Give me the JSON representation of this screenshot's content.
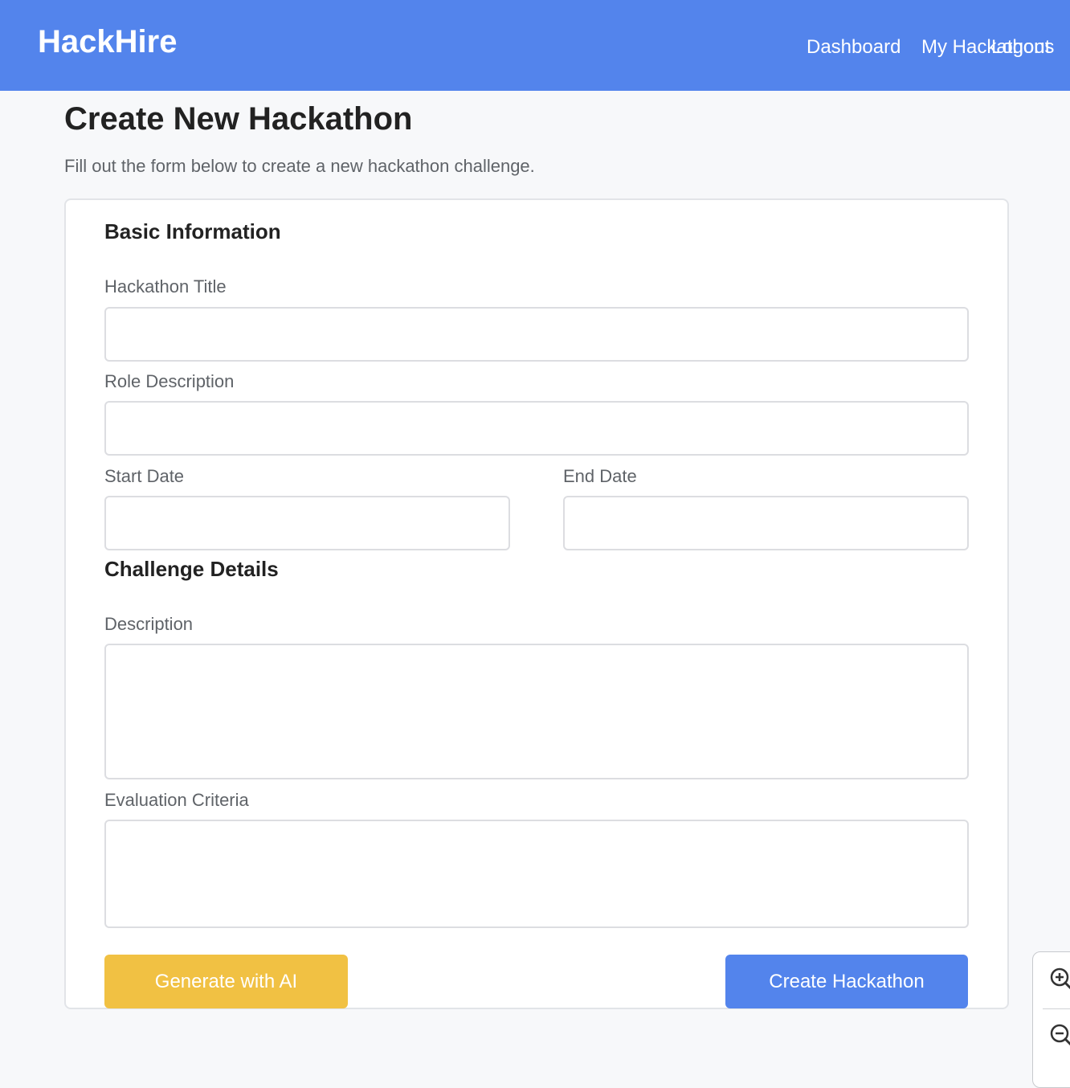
{
  "header": {
    "brand": "HackHire",
    "nav": {
      "dashboard": "Dashboard",
      "my_hackathons": "My Hackathons",
      "logout": "Logout"
    }
  },
  "page": {
    "title": "Create New Hackathon",
    "subtitle": "Fill out the form below to create a new hackathon challenge."
  },
  "form": {
    "basic_section_title": "Basic Information",
    "challenge_section_title": "Challenge Details",
    "fields": {
      "title_label": "Hackathon Title",
      "title_value": "",
      "role_label": "Role Description",
      "role_value": "",
      "start_label": "Start Date",
      "start_value": "",
      "end_label": "End Date",
      "end_value": "",
      "description_label": "Description",
      "description_value": "",
      "criteria_label": "Evaluation Criteria",
      "criteria_value": ""
    },
    "buttons": {
      "generate_ai": "Generate with AI",
      "create": "Create Hackathon"
    }
  },
  "zoom_controls": {
    "zoom_in_icon": "zoom-in-icon",
    "zoom_out_icon": "zoom-out-icon"
  },
  "colors": {
    "primary": "#5384ec",
    "accent": "#f1c143",
    "background": "#f7f8fa"
  }
}
